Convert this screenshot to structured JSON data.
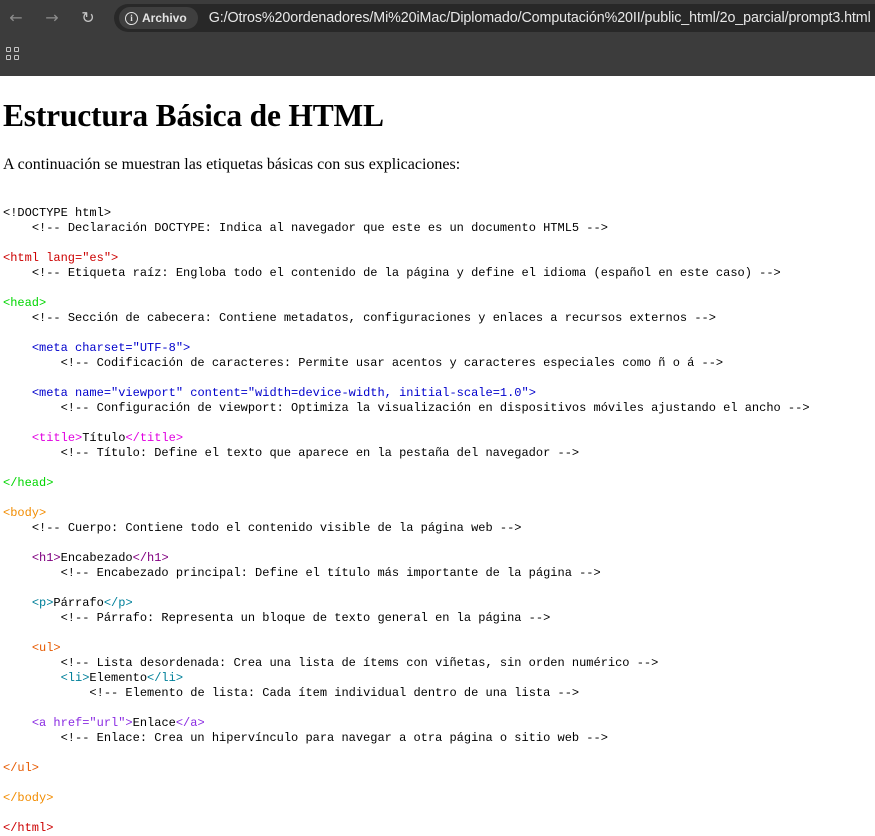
{
  "browser": {
    "back_icon": "←",
    "forward_icon": "→",
    "reload_icon": "↻",
    "site_chip_label": "Archivo",
    "url": "G:/Otros%20ordenadores/Mi%20iMac/Diplomado/Computación%20II/public_html/2o_parcial/prompt3.html"
  },
  "page": {
    "title": "Estructura Básica de HTML",
    "intro": "A continuación se muestran las etiquetas básicas con sus explicaciones:"
  },
  "code": {
    "doctype": "<!DOCTYPE html>",
    "doctype_comment": "<!-- Declaración DOCTYPE: Indica al navegador que este es un documento HTML5 -->",
    "html_open": "<html lang=\"es\">",
    "html_comment": "<!-- Etiqueta raíz: Engloba todo el contenido de la página y define el idioma (español en este caso) -->",
    "head_open": "<head>",
    "head_comment": "<!-- Sección de cabecera: Contiene metadatos, configuraciones y enlaces a recursos externos -->",
    "meta_charset": "<meta charset=\"UTF-8\">",
    "meta_charset_comment": "<!-- Codificación de caracteres: Permite usar acentos y caracteres especiales como ñ o á -->",
    "meta_viewport": "<meta name=\"viewport\" content=\"width=device-width, initial-scale=1.0\">",
    "meta_viewport_comment": "<!-- Configuración de viewport: Optimiza la visualización en dispositivos móviles ajustando el ancho -->",
    "title_open": "<title>",
    "title_text": "Título",
    "title_close": "</title>",
    "title_comment": "<!-- Título: Define el texto que aparece en la pestaña del navegador -->",
    "head_close": "</head>",
    "body_open": "<body>",
    "body_comment": "<!-- Cuerpo: Contiene todo el contenido visible de la página web -->",
    "h1_open": "<h1>",
    "h1_text": "Encabezado",
    "h1_close": "</h1>",
    "h1_comment": "<!-- Encabezado principal: Define el título más importante de la página -->",
    "p_open": "<p>",
    "p_text": "Párrafo",
    "p_close": "</p>",
    "p_comment": "<!-- Párrafo: Representa un bloque de texto general en la página -->",
    "ul_open": "<ul>",
    "ul_comment": "<!-- Lista desordenada: Crea una lista de ítems con viñetas, sin orden numérico -->",
    "li_open": "<li>",
    "li_text": "Elemento",
    "li_close": "</li>",
    "li_comment": "<!-- Elemento de lista: Cada ítem individual dentro de una lista -->",
    "a_open": "<a href=\"url\">",
    "a_text": "Enlace",
    "a_close": "</a>",
    "a_comment": "<!-- Enlace: Crea un hipervínculo para navegar a otra página o sitio web -->",
    "ul_close": "</ul>",
    "body_close": "</body>",
    "html_close": "</html>"
  }
}
